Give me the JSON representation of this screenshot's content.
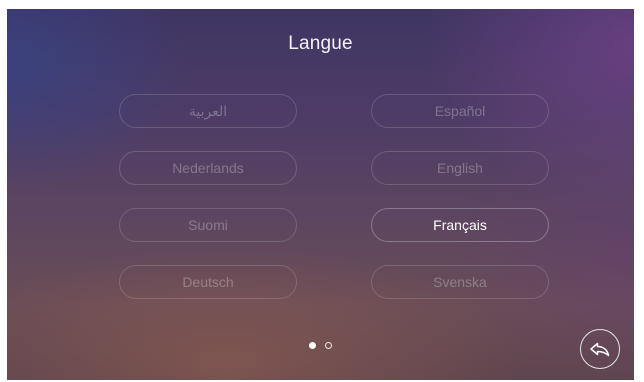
{
  "header": {
    "title": "Langue"
  },
  "languages": [
    {
      "label": "العربية",
      "selected": false
    },
    {
      "label": "Español",
      "selected": false
    },
    {
      "label": "Nederlands",
      "selected": false
    },
    {
      "label": "English",
      "selected": false
    },
    {
      "label": "Suomi",
      "selected": false
    },
    {
      "label": "Français",
      "selected": true
    },
    {
      "label": "Deutsch",
      "selected": false
    },
    {
      "label": "Svenska",
      "selected": false
    }
  ],
  "pagination": {
    "current_page": 1,
    "total_pages": 2
  },
  "icons": {
    "back": "back-arrow-icon"
  }
}
